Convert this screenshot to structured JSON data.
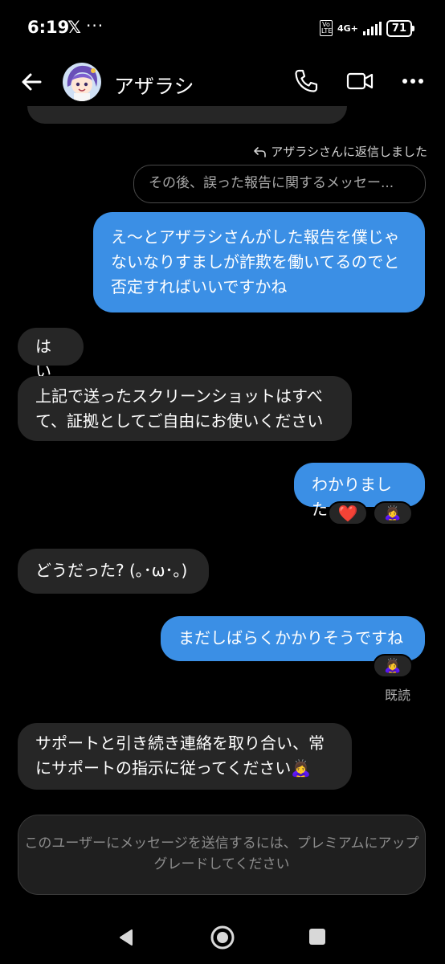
{
  "status_bar": {
    "time": "6:19",
    "x_icon": "𝕏",
    "dots": "···",
    "volte": "Vo LTE",
    "network": "4G+",
    "battery": "71"
  },
  "header": {
    "contact_name": "アザラシ",
    "back_icon": "arrow-left-icon",
    "call_icon": "phone-icon",
    "video_icon": "video-icon",
    "more_icon": "more-icon"
  },
  "reply": {
    "note": "アザラシさんに返信しました",
    "quoted": "その後、誤った報告に関するメッセー..."
  },
  "messages": [
    {
      "dir": "out",
      "text": "え〜とアザラシさんがした報告を僕じゃないなりすましが詐欺を働いてるのでと否定すればいいですかね"
    },
    {
      "dir": "in",
      "text": "はい"
    },
    {
      "dir": "in",
      "text": "上記で送ったスクリーンショットはすべて、証拠としてご自由にお使いください"
    },
    {
      "dir": "out",
      "text": "わかりました",
      "reactions": [
        "❤️",
        "🙇‍♀️"
      ]
    },
    {
      "dir": "in",
      "text": "どうだった? (｡･ω･｡)"
    },
    {
      "dir": "out",
      "text": "まだしばらくかかりそうですね",
      "reactions": [
        "🙇‍♀️"
      ]
    },
    {
      "dir": "in",
      "text": "サポートと引き続き連絡を取り合い、常にサポートの指示に従ってください🙇‍♀️"
    }
  ],
  "read_status": "既読",
  "composer": {
    "notice": "このユーザーにメッセージを送信するには、プレミアムにアップグレードしてください"
  },
  "navigation": {
    "back": "back-triangle-icon",
    "home": "home-circle-icon",
    "recents": "recents-square-icon"
  },
  "colors": {
    "background": "#000000",
    "outgoing_bubble": "#3b8fe5",
    "incoming_bubble": "#262626",
    "heart": "#e0243b"
  }
}
